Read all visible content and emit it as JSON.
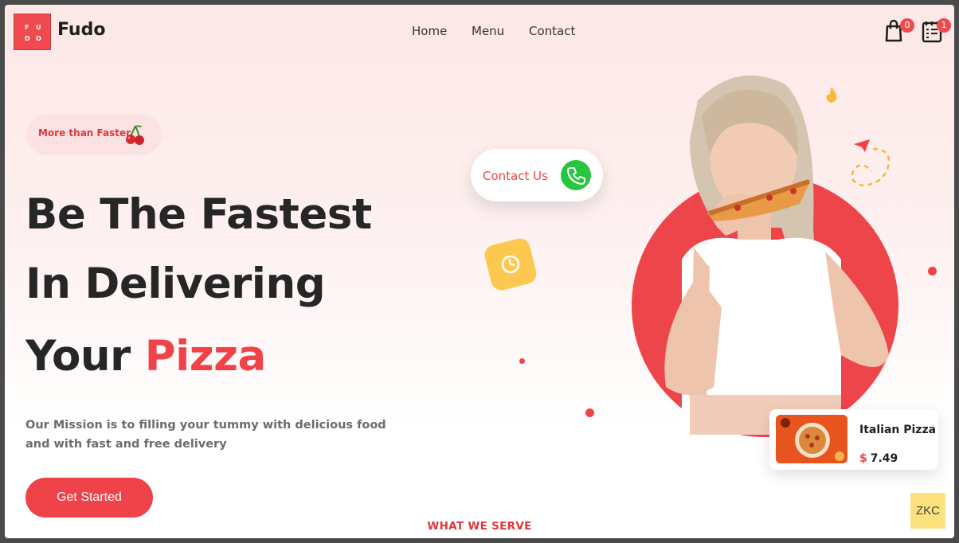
{
  "brand": {
    "logo_letters": [
      "F",
      "U",
      "D",
      "O"
    ],
    "name": "Fudo"
  },
  "nav": {
    "items": [
      "Home",
      "Menu",
      "Contact"
    ]
  },
  "header_icons": {
    "cart_count": "0",
    "orders_count": "1",
    "cart_icon": "shopping-bag-icon",
    "orders_icon": "receipt-icon"
  },
  "hero": {
    "tagline": "More than Faster",
    "tagline_icon": "cherry-icon",
    "headline_line1": "Be The Fastest",
    "headline_line2": "In Delivering",
    "headline_line3_prefix": "Your",
    "headline_line3_accent": "Pizza",
    "mission": "Our Mission is to filling your tummy with delicious food and with fast and free delivery",
    "cta_label": "Get Started"
  },
  "contact_card": {
    "label": "Contact Us",
    "icon": "phone-icon"
  },
  "featured": {
    "name": "Italian Pizza",
    "currency": "$",
    "price": "7.49"
  },
  "section_label": "WHAT WE SERVE",
  "watermark": "ZKC",
  "colors": {
    "accent": "#ef4349",
    "phone_green": "#27c640",
    "clock_yellow": "#fcc850"
  }
}
